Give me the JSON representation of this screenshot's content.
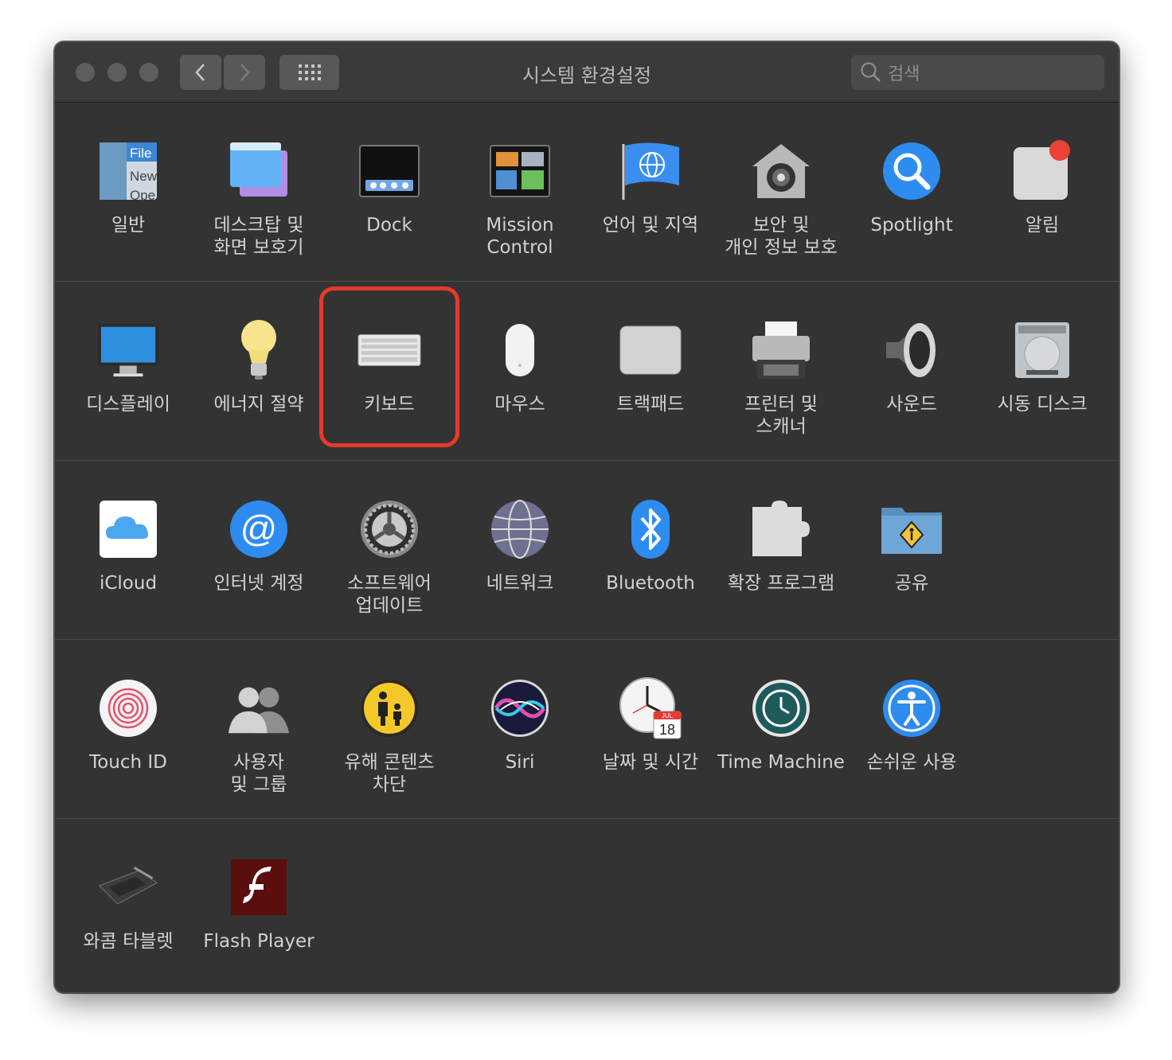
{
  "window": {
    "title": "시스템 환경설정",
    "search_placeholder": "검색"
  },
  "colors": {
    "window_bg": "#333333",
    "titlebar_bg": "#3a3a3c",
    "label_text": "#d2d2d2",
    "highlight": "#e8392a"
  },
  "rows": [
    {
      "panes": [
        {
          "label": "일반",
          "icon": "general-icon"
        },
        {
          "label": "데스크탑 및\n화면 보호기",
          "icon": "desktop-screensaver-icon"
        },
        {
          "label": "Dock",
          "icon": "dock-icon"
        },
        {
          "label": "Mission\nControl",
          "icon": "mission-control-icon"
        },
        {
          "label": "언어 및 지역",
          "icon": "language-region-icon"
        },
        {
          "label": "보안 및\n개인 정보 보호",
          "icon": "security-privacy-icon"
        },
        {
          "label": "Spotlight",
          "icon": "spotlight-icon"
        },
        {
          "label": "알림",
          "icon": "notifications-icon"
        }
      ]
    },
    {
      "panes": [
        {
          "label": "디스플레이",
          "icon": "displays-icon"
        },
        {
          "label": "에너지 절약",
          "icon": "energy-saver-icon"
        },
        {
          "label": "키보드",
          "icon": "keyboard-icon",
          "highlighted": true
        },
        {
          "label": "마우스",
          "icon": "mouse-icon"
        },
        {
          "label": "트랙패드",
          "icon": "trackpad-icon"
        },
        {
          "label": "프린터 및\n스캐너",
          "icon": "printers-scanners-icon"
        },
        {
          "label": "사운드",
          "icon": "sound-icon"
        },
        {
          "label": "시동 디스크",
          "icon": "startup-disk-icon"
        }
      ]
    },
    {
      "panes": [
        {
          "label": "iCloud",
          "icon": "icloud-icon"
        },
        {
          "label": "인터넷 계정",
          "icon": "internet-accounts-icon"
        },
        {
          "label": "소프트웨어\n업데이트",
          "icon": "software-update-icon"
        },
        {
          "label": "네트워크",
          "icon": "network-icon"
        },
        {
          "label": "Bluetooth",
          "icon": "bluetooth-icon"
        },
        {
          "label": "확장 프로그램",
          "icon": "extensions-icon"
        },
        {
          "label": "공유",
          "icon": "sharing-icon"
        }
      ]
    },
    {
      "panes": [
        {
          "label": "Touch ID",
          "icon": "touch-id-icon"
        },
        {
          "label": "사용자\n및 그룹",
          "icon": "users-groups-icon"
        },
        {
          "label": "유해 콘텐츠\n차단",
          "icon": "parental-controls-icon"
        },
        {
          "label": "Siri",
          "icon": "siri-icon"
        },
        {
          "label": "날짜 및 시간",
          "icon": "date-time-icon"
        },
        {
          "label": "Time Machine",
          "icon": "time-machine-icon"
        },
        {
          "label": "손쉬운 사용",
          "icon": "accessibility-icon"
        }
      ]
    },
    {
      "panes": [
        {
          "label": "와콤 타블렛",
          "icon": "wacom-tablet-icon"
        },
        {
          "label": "Flash Player",
          "icon": "flash-player-icon"
        }
      ]
    }
  ],
  "icon_text": {
    "general_file": "File",
    "general_new": "New",
    "general_open": "Ope",
    "calendar_month": "JUL",
    "calendar_day": "18"
  }
}
